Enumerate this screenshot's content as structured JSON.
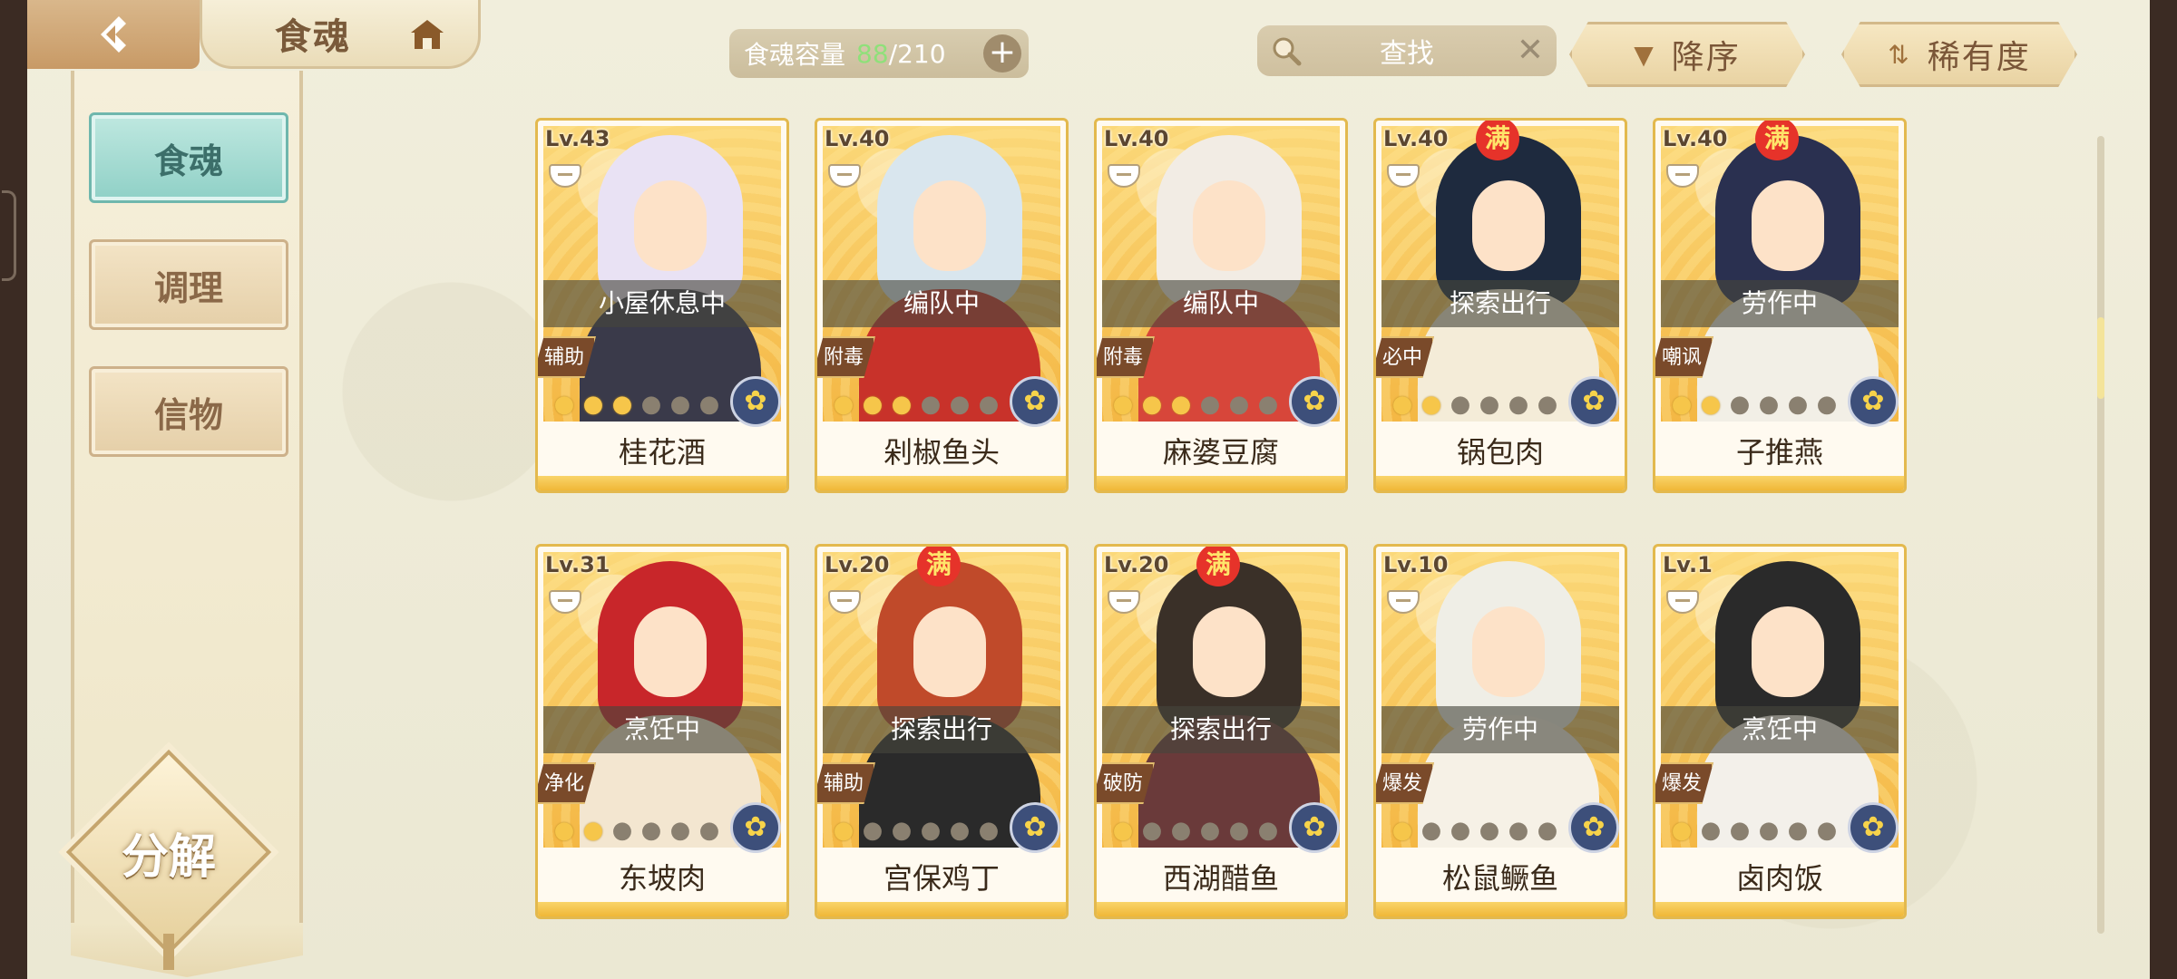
{
  "header": {
    "title": "食魂",
    "capacity_label": "食魂容量",
    "capacity_current": "88",
    "capacity_max": "/210",
    "search_label": "查找",
    "sort_order_label": "降序",
    "sort_key_label": "稀有度"
  },
  "sidebar": {
    "items": [
      {
        "label": "食魂",
        "active": true
      },
      {
        "label": "调理",
        "active": false
      },
      {
        "label": "信物",
        "active": false
      }
    ],
    "decompose_label": "分解"
  },
  "colors": {
    "accent_gold": "#e3b94e",
    "active_tab": "#8fd0c6",
    "full_badge": "#e6332a",
    "capacity_number": "#8fe07a"
  },
  "full_badge_text": "满",
  "cards": [
    {
      "level": "Lv.43",
      "status": "小屋休息中",
      "role": "辅助",
      "name": "桂花酒",
      "stars": 3,
      "full": false,
      "hair": "#e9e2f4",
      "body": "#3a3a4a"
    },
    {
      "level": "Lv.40",
      "status": "编队中",
      "role": "附毒",
      "name": "剁椒鱼头",
      "stars": 3,
      "full": false,
      "hair": "#d9e6ee",
      "body": "#c8322a"
    },
    {
      "level": "Lv.40",
      "status": "编队中",
      "role": "附毒",
      "name": "麻婆豆腐",
      "stars": 3,
      "full": false,
      "hair": "#f2ece4",
      "body": "#d7463a"
    },
    {
      "level": "Lv.40",
      "status": "探索出行",
      "role": "必中",
      "name": "锅包肉",
      "stars": 2,
      "full": true,
      "hair": "#1e2a3e",
      "body": "#f4ecd8"
    },
    {
      "level": "Lv.40",
      "status": "劳作中",
      "role": "嘲讽",
      "name": "子推燕",
      "stars": 2,
      "full": true,
      "hair": "#2a3050",
      "body": "#f2efe6"
    },
    {
      "level": "Lv.31",
      "status": "烹饪中",
      "role": "净化",
      "name": "东坡肉",
      "stars": 2,
      "full": false,
      "hair": "#c8262a",
      "body": "#f3e6d0"
    },
    {
      "level": "Lv.20",
      "status": "探索出行",
      "role": "辅助",
      "name": "宫保鸡丁",
      "stars": 1,
      "full": true,
      "hair": "#c04a2a",
      "body": "#2a2a2a"
    },
    {
      "level": "Lv.20",
      "status": "探索出行",
      "role": "破防",
      "name": "西湖醋鱼",
      "stars": 1,
      "full": true,
      "hair": "#3a3028",
      "body": "#6a3a3a"
    },
    {
      "level": "Lv.10",
      "status": "劳作中",
      "role": "爆发",
      "name": "松鼠鳜鱼",
      "stars": 1,
      "full": false,
      "hair": "#efeee6",
      "body": "#f6f1e6"
    },
    {
      "level": "Lv.1",
      "status": "烹饪中",
      "role": "爆发",
      "name": "卤肉饭",
      "stars": 1,
      "full": false,
      "hair": "#2a2a2a",
      "body": "#f3f0ea"
    }
  ]
}
